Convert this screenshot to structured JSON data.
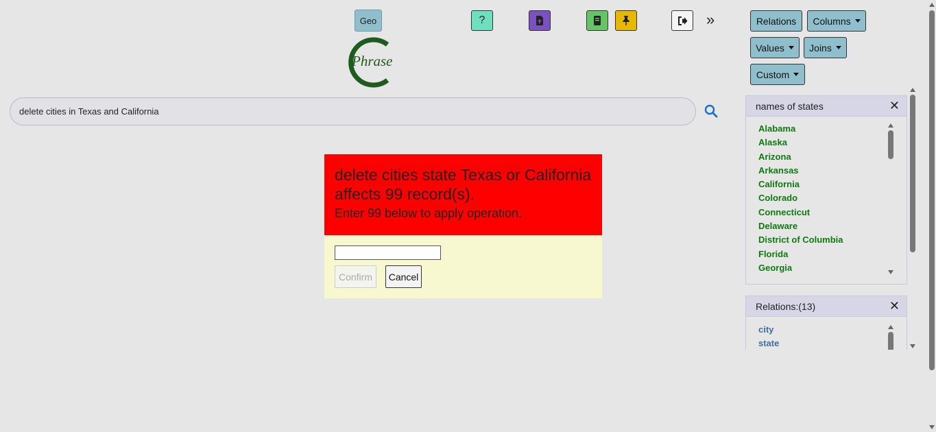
{
  "header": {
    "geo_label": "Geo",
    "logo_text": "Phrase",
    "help_label": "?",
    "more_label": "»"
  },
  "toolbar": {
    "relations": "Relations",
    "columns": "Columns",
    "values": "Values",
    "joins": "Joins",
    "custom": "Custom"
  },
  "search": {
    "value": "delete cities in Texas and California"
  },
  "dialog": {
    "line1": "delete cities state Texas or California affects 99 record(s).",
    "line2": "Enter 99 below to apply operation.",
    "confirm": "Confirm",
    "cancel": "Cancel"
  },
  "states_panel": {
    "title": "names of states",
    "close": "✕",
    "items": [
      "Alabama",
      "Alaska",
      "Arizona",
      "Arkansas",
      "California",
      "Colorado",
      "Connecticut",
      "Delaware",
      "District of Columbia",
      "Florida",
      "Georgia"
    ]
  },
  "relations_panel": {
    "title": "Relations:(13)",
    "close": "✕",
    "items": [
      "city",
      "state"
    ]
  },
  "colors": {
    "help": "#6ee0c0",
    "upload": "#7a52c0",
    "book": "#66c466",
    "pin": "#e6b800",
    "dialog_head": "#ff0000",
    "dialog_body": "#f7f8d0",
    "state_link": "#0d7a0d",
    "relation_link": "#3f6f9f",
    "logo": "#1f5a1f"
  }
}
